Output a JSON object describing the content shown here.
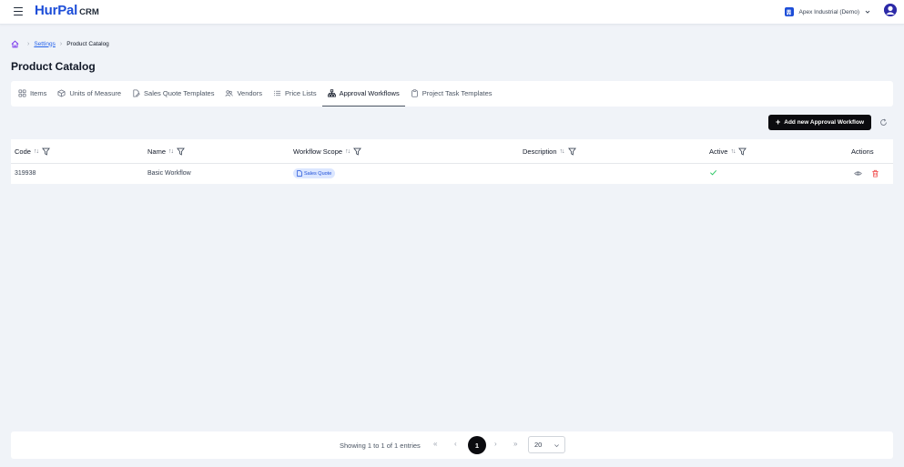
{
  "app": {
    "brand_name": "HurPal",
    "brand_suffix": "CRM"
  },
  "header": {
    "org_name": "Apex Industrial (Demo)"
  },
  "breadcrumb": {
    "settings": "Settings",
    "current": "Product Catalog"
  },
  "page": {
    "title": "Product Catalog"
  },
  "tabs": [
    {
      "label": "Items",
      "icon": "grid-icon"
    },
    {
      "label": "Units of Measure",
      "icon": "cube-icon"
    },
    {
      "label": "Sales Quote Templates",
      "icon": "document-edit-icon"
    },
    {
      "label": "Vendors",
      "icon": "users-icon"
    },
    {
      "label": "Price Lists",
      "icon": "list-icon"
    },
    {
      "label": "Approval Workflows",
      "icon": "workflow-icon",
      "active": true
    },
    {
      "label": "Project Task Templates",
      "icon": "clipboard-icon"
    }
  ],
  "toolbar": {
    "add_label": "Add new Approval Workflow"
  },
  "table": {
    "columns": {
      "code": "Code",
      "name": "Name",
      "scope": "Workflow Scope",
      "description": "Description",
      "active": "Active",
      "actions": "Actions"
    },
    "rows": [
      {
        "code": "319938",
        "name": "Basic Workflow",
        "scope": "Sales Quote",
        "description": "",
        "active": true
      }
    ]
  },
  "pagination": {
    "info": "Showing 1 to 1 of 1 entries",
    "first": "«",
    "prev": "‹",
    "current": "1",
    "next": "›",
    "last": "»",
    "page_size": "20"
  },
  "colors": {
    "accent": "#1d4ed8",
    "button": "#0b0b0f",
    "background": "#f0f3f8",
    "success": "#22c55e",
    "danger": "#ef4444"
  }
}
